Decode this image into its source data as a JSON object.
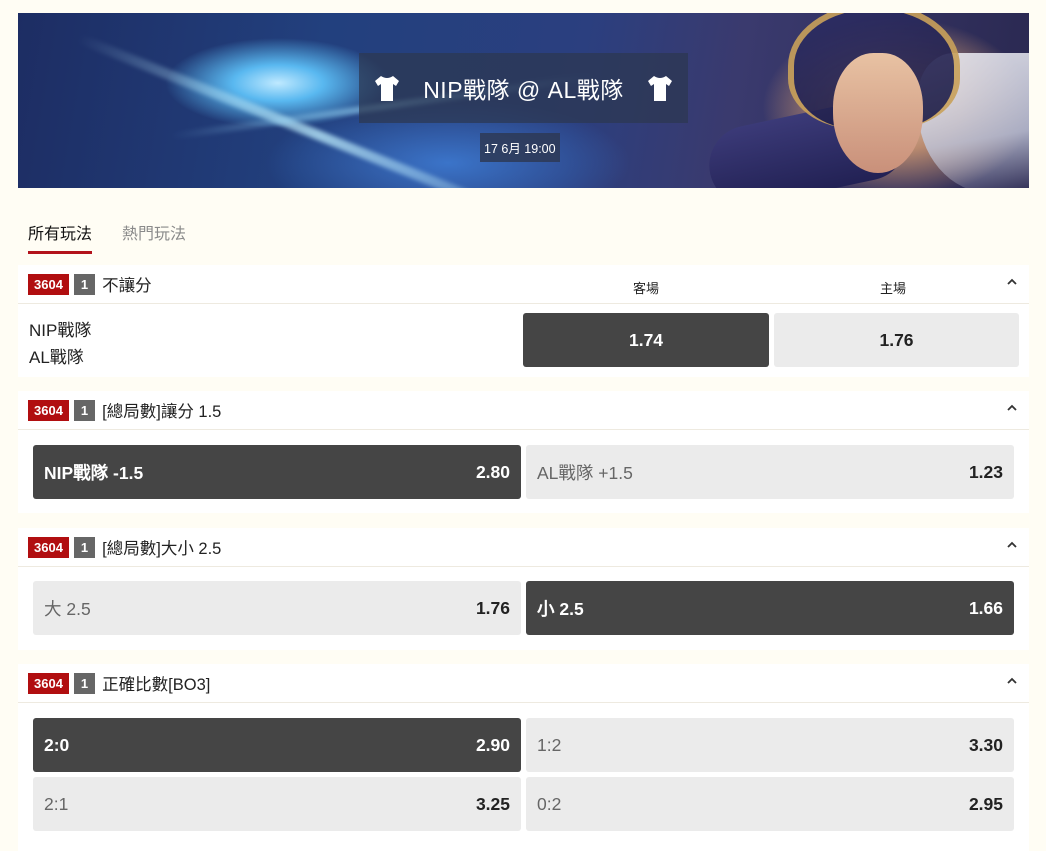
{
  "banner": {
    "match_title": "NIP戰隊 @ AL戰隊",
    "datetime": "17 6月 19:00"
  },
  "tabs": [
    "所有玩法",
    "熱門玩法"
  ],
  "markets": [
    {
      "id": "3604",
      "num": "1",
      "title": "不讓分",
      "columns": [
        "客場",
        "主場"
      ],
      "teams": [
        "NIP戰隊",
        "AL戰隊"
      ],
      "odds": [
        "1.74",
        "1.76"
      ]
    },
    {
      "id": "3604",
      "num": "1",
      "title": "[總局數]讓分 1.5",
      "options": [
        {
          "label": "NIP戰隊 -1.5",
          "odds": "2.80"
        },
        {
          "label": "AL戰隊 +1.5",
          "odds": "1.23"
        }
      ]
    },
    {
      "id": "3604",
      "num": "1",
      "title": "[總局數]大小 2.5",
      "options": [
        {
          "label": "大 2.5",
          "odds": "1.76"
        },
        {
          "label": "小 2.5",
          "odds": "1.66"
        }
      ]
    },
    {
      "id": "3604",
      "num": "1",
      "title": "正確比數[BO3]",
      "options": [
        {
          "label": "2:0",
          "odds": "2.90"
        },
        {
          "label": "1:2",
          "odds": "3.30"
        },
        {
          "label": "2:1",
          "odds": "3.25"
        },
        {
          "label": "0:2",
          "odds": "2.95"
        }
      ]
    }
  ],
  "colors": {
    "accent_red": "#b10e10",
    "selected_dark": "#454545",
    "unselected_light": "#ebebeb"
  }
}
